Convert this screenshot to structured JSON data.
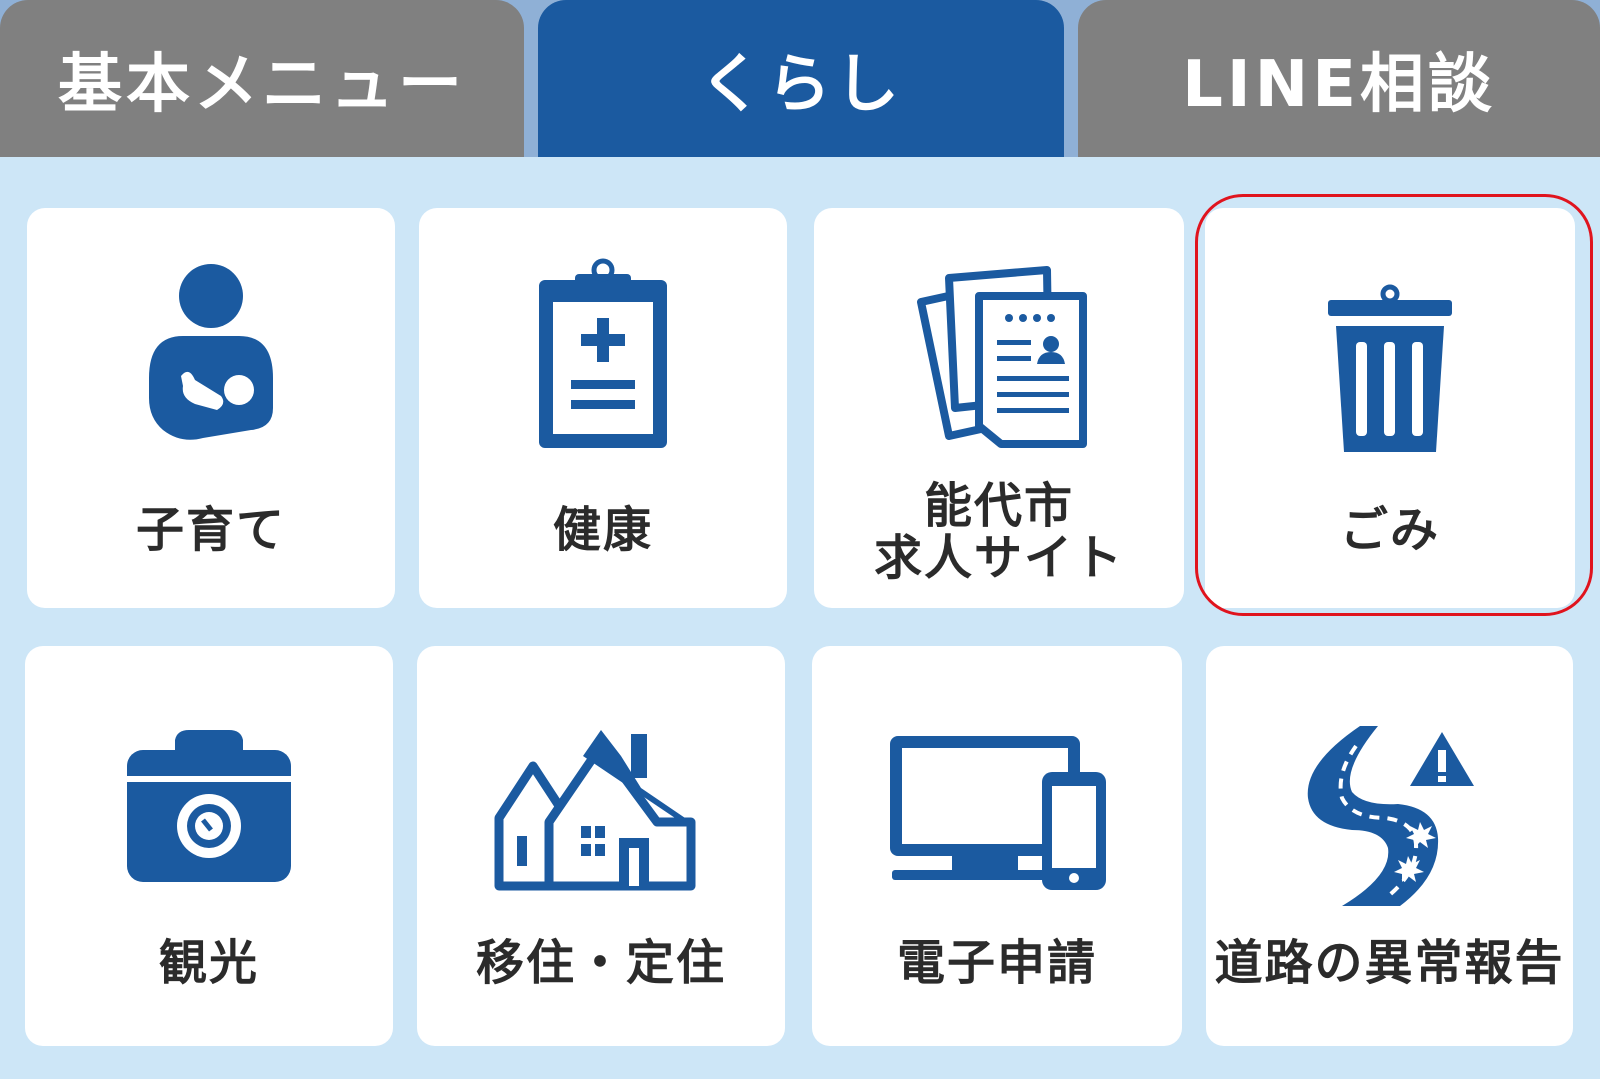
{
  "tabs": [
    {
      "label": "基本メニュー",
      "active": false
    },
    {
      "label": "くらし",
      "active": true
    },
    {
      "label": "LINE相談",
      "active": false
    }
  ],
  "menu": {
    "items": [
      {
        "label": "子育て",
        "icon": "parenting-icon"
      },
      {
        "label": "健康",
        "icon": "health-clipboard-icon"
      },
      {
        "label_line1": "能代市",
        "label_line2": "求人サイト",
        "icon": "job-documents-icon"
      },
      {
        "label": "ごみ",
        "icon": "trash-can-icon",
        "highlighted": true
      },
      {
        "label": "観光",
        "icon": "camera-icon"
      },
      {
        "label": "移住・定住",
        "icon": "houses-icon"
      },
      {
        "label": "電子申請",
        "icon": "devices-icon"
      },
      {
        "label": "道路の異常報告",
        "icon": "road-warning-icon"
      }
    ]
  },
  "colors": {
    "background": "#cde6f7",
    "tab_active": "#1b5aa0",
    "tab_inactive": "#808080",
    "icon": "#1b5aa0",
    "highlight": "#e0141e"
  }
}
